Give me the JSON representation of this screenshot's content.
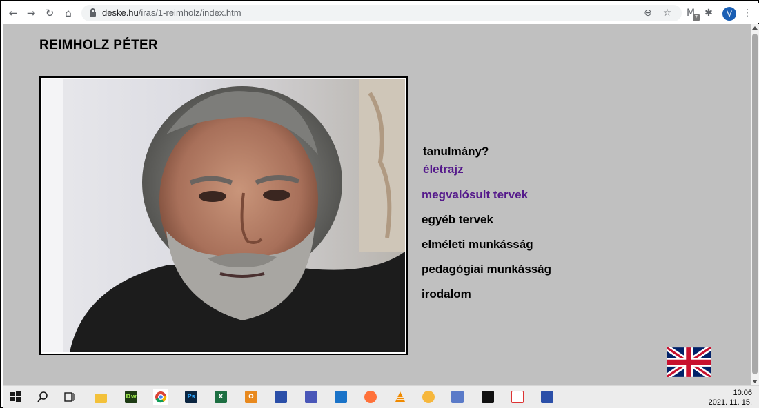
{
  "browser": {
    "url_domain": "deske.hu",
    "url_path": "/iras/1-reimholz/index.htm",
    "profile_initial": "V",
    "ext_badge": "7"
  },
  "page": {
    "title": "REIMHOLZ PÉTER",
    "photo_alt": "",
    "nav": [
      {
        "label": "tanulmány?",
        "color": "#000000"
      },
      {
        "label": "életrajz",
        "color": "#551a8b"
      },
      {
        "label": "megvalósult tervek",
        "color": "#551a8b"
      },
      {
        "label": "egyéb tervek",
        "color": "#000000"
      },
      {
        "label": "elméleti munkásság",
        "color": "#000000"
      },
      {
        "label": "pedagógiai munkásság",
        "color": "#000000"
      },
      {
        "label": "irodalom",
        "color": "#000000"
      }
    ],
    "language_flag": "uk-flag-icon"
  },
  "taskbar": {
    "apps": [
      "windows-start-icon",
      "search-icon",
      "task-view-icon",
      "file-explorer-icon",
      "dreamweaver-icon",
      "chrome-icon",
      "photoshop-icon",
      "excel-icon",
      "outlook-icon",
      "floppy-icon",
      "outlook-2-icon",
      "snipping-tool-icon",
      "firefox-icon",
      "vlc-icon",
      "media-player-icon",
      "network-icon",
      "terminal-icon",
      "java-icon",
      "floppy-2-icon"
    ],
    "app_labels": {
      "dreamweaver": "Dw",
      "photoshop": "Ps",
      "excel": "X",
      "outlook": "O"
    },
    "time": "10:06",
    "date": "2021. 11. 15."
  }
}
